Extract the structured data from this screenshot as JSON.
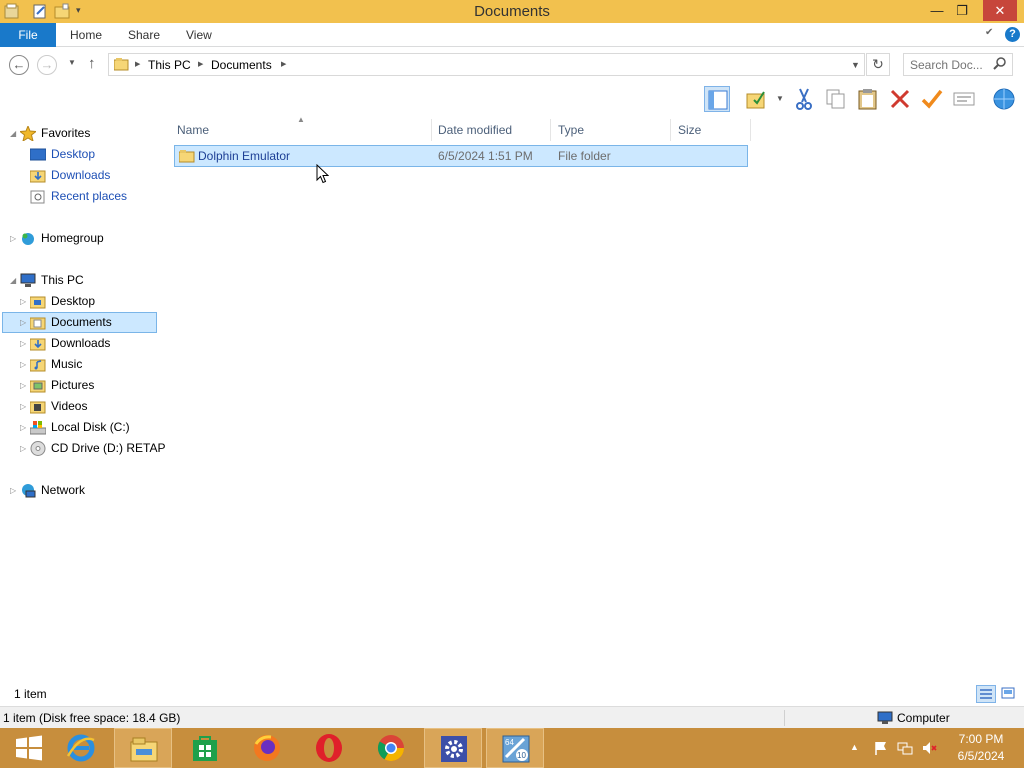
{
  "window": {
    "title": "Documents"
  },
  "titlebar": {
    "minimize": "—",
    "restore": "❐",
    "close": "✕"
  },
  "ribbon": {
    "tabs": [
      "File",
      "Home",
      "Share",
      "View"
    ]
  },
  "address": {
    "crumbs": [
      "This PC",
      "Documents"
    ],
    "search_placeholder": "Search Doc..."
  },
  "navpane": {
    "favorites": {
      "label": "Favorites",
      "items": [
        "Desktop",
        "Downloads",
        "Recent places"
      ]
    },
    "homegroup": "Homegroup",
    "thispc": {
      "label": "This PC",
      "items": [
        "Desktop",
        "Documents",
        "Downloads",
        "Music",
        "Pictures",
        "Videos",
        "Local Disk (C:)",
        "CD Drive (D:) RETAP"
      ]
    },
    "network": "Network"
  },
  "filelist": {
    "columns": [
      "Name",
      "Date modified",
      "Type",
      "Size"
    ],
    "rows": [
      {
        "name": "Dolphin Emulator",
        "date": "6/5/2024 1:51 PM",
        "type": "File folder",
        "size": ""
      }
    ]
  },
  "status": {
    "count": "1 item"
  },
  "details": {
    "info": "1 item (Disk free space: 18.4 GB)",
    "location": "Computer"
  },
  "taskbar": {
    "time": "7:00 PM",
    "date": "6/5/2024",
    "accent": "#c78e3d"
  }
}
